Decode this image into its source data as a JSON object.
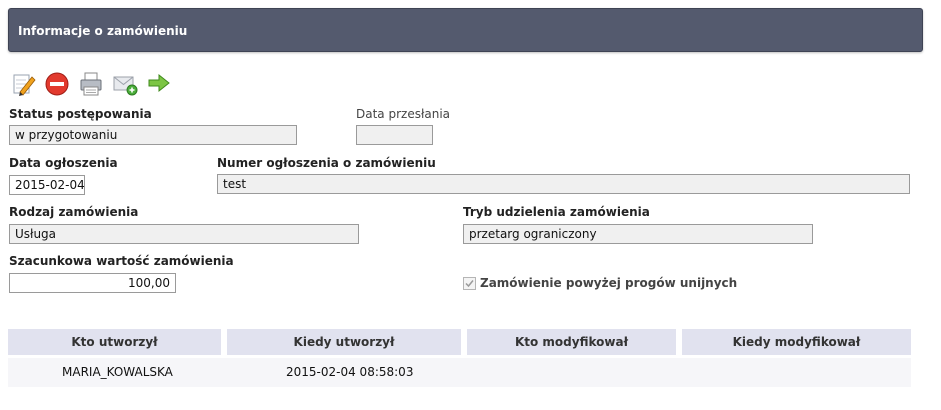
{
  "header": {
    "title": "Informacje o zamówieniu"
  },
  "toolbar": {
    "items": [
      {
        "icon": "pencil-icon",
        "name": "edit"
      },
      {
        "icon": "no-entry-icon",
        "name": "delete"
      },
      {
        "icon": "printer-icon",
        "name": "print"
      },
      {
        "icon": "send-mail-icon",
        "name": "send"
      },
      {
        "icon": "arrow-right-icon",
        "name": "forward"
      }
    ]
  },
  "form": {
    "status": {
      "label": "Status postępowania",
      "value": "w przygotowaniu"
    },
    "data_przeslania": {
      "label": "Data przesłania",
      "value": ""
    },
    "data_ogloszenia": {
      "label": "Data ogłoszenia",
      "value": "2015-02-04"
    },
    "numer_ogloszenia": {
      "label": "Numer ogłoszenia o zamówieniu",
      "value": "test"
    },
    "rodzaj": {
      "label": "Rodzaj zamówienia",
      "value": "Usługa"
    },
    "tryb": {
      "label": "Tryb udzielenia zamówienia",
      "value": "przetarg ograniczony"
    },
    "wartosc": {
      "label": "Szacunkowa wartość zamówienia",
      "value": "100,00"
    },
    "powyzej_progow": {
      "label": "Zamówienie powyżej progów unijnych",
      "checked": true
    }
  },
  "audit_table": {
    "headers": [
      "Kto utworzył",
      "Kiedy utworzył",
      "Kto modyfikował",
      "Kiedy modyfikował"
    ],
    "row": [
      "MARIA_KOWALSKA",
      "2015-02-04 08:58:03",
      "",
      ""
    ]
  },
  "colors": {
    "header_bg": "#545a6e",
    "table_header_bg": "#e1e2ef",
    "field_bg": "#f0f0f0"
  }
}
